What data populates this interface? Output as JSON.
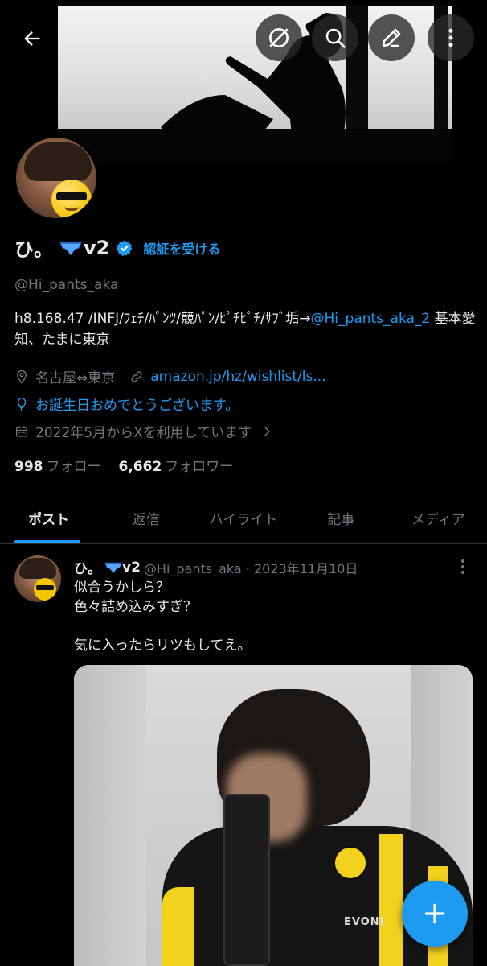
{
  "profile": {
    "name": "ひ。",
    "name_suffix": "v2",
    "get_verified_label": "認証を受ける",
    "handle": "@Hi_pants_aka",
    "bio_text": "h8.168.47 /INFJ/ﾌｪﾁ/ﾊﾟﾝﾂ/競ﾊﾟﾝ/ﾋﾟﾁﾋﾟﾁ/ｻﾌﾞ垢→",
    "bio_link": "@Hi_pants_aka_2",
    "bio_text_end": " 基本愛知、たまに東京",
    "location": "名古屋⇔東京",
    "website": "amazon.jp/hz/wishlist/ls...",
    "birthday_message": "お誕生日おめでとうございます。",
    "joined": "2022年5月からXを利用しています",
    "following_count": "998",
    "following_label": "フォロー",
    "followers_count": "6,662",
    "followers_label": "フォロワー"
  },
  "tabs": [
    {
      "label": "ポスト",
      "active": true
    },
    {
      "label": "返信",
      "active": false
    },
    {
      "label": "ハイライト",
      "active": false
    },
    {
      "label": "記事",
      "active": false
    },
    {
      "label": "メディア",
      "active": false
    }
  ],
  "post": {
    "name": "ひ。",
    "name_suffix": "v2",
    "handle_date": "@Hi_pants_aka · 2023年11月10日",
    "text": "似合うかしら？\n色々詰め込みすぎ？\n\n気に入ったらリツもしてえ。",
    "media_text": "EVONI"
  },
  "icons": {
    "back": "arrow-left-icon",
    "grok": "grok-icon",
    "search": "search-icon",
    "edit": "pencil-icon",
    "more": "more-vertical-icon",
    "compose": "plus-icon"
  },
  "colors": {
    "accent": "#1d9bf0",
    "background": "#000000",
    "text_primary": "#e7e9ea",
    "text_secondary": "#71767b"
  }
}
